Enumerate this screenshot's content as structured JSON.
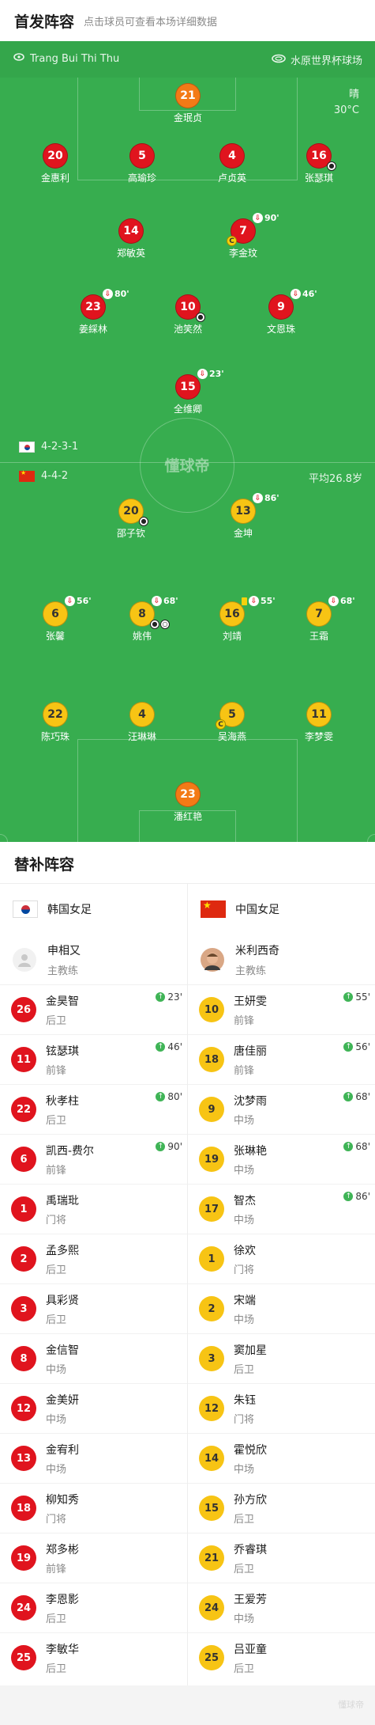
{
  "header": {
    "title": "首发阵容",
    "subtitle": "点击球员可查看本场详细数据"
  },
  "pitch": {
    "referee": "Trang Bui Thi Thu",
    "venue": "水原世界杯球场",
    "weather": "晴",
    "temperature": "30°C",
    "watermark": "懂球帝",
    "home_formation": "4-2-3-1",
    "away_formation": "4-4-2",
    "avg_age": "平均26.8岁"
  },
  "home_lineup": {
    "gk": {
      "num": "21",
      "name": "金珉贞"
    },
    "d1": {
      "num": "20",
      "name": "金惠利"
    },
    "d2": {
      "num": "5",
      "name": "高瑜珍"
    },
    "d3": {
      "num": "4",
      "name": "卢贞英"
    },
    "d4": {
      "num": "16",
      "name": "张瑟琪"
    },
    "m1": {
      "num": "14",
      "name": "郑敏英"
    },
    "m2": {
      "num": "7",
      "name": "李金玟",
      "sub": "90'"
    },
    "a1": {
      "num": "23",
      "name": "姜綵林",
      "sub": "80'"
    },
    "a2": {
      "num": "10",
      "name": "池笑然"
    },
    "a3": {
      "num": "9",
      "name": "文恩珠",
      "sub": "46'"
    },
    "st": {
      "num": "15",
      "name": "全维卿",
      "sub": "23'"
    }
  },
  "away_lineup": {
    "f1": {
      "num": "20",
      "name": "邵子钦"
    },
    "f2": {
      "num": "13",
      "name": "金坤",
      "sub": "86'"
    },
    "m1": {
      "num": "6",
      "name": "张馨",
      "sub": "56'"
    },
    "m2": {
      "num": "8",
      "name": "姚伟",
      "sub": "68'"
    },
    "m3": {
      "num": "16",
      "name": "刘靖",
      "sub": "55'"
    },
    "m4": {
      "num": "7",
      "name": "王霜",
      "sub": "68'"
    },
    "d1": {
      "num": "22",
      "name": "陈巧珠"
    },
    "d2": {
      "num": "4",
      "name": "汪琳琳"
    },
    "d3": {
      "num": "5",
      "name": "吴海燕"
    },
    "d4": {
      "num": "11",
      "name": "李梦雯"
    },
    "gk": {
      "num": "23",
      "name": "潘红艳"
    }
  },
  "subs": {
    "title": "替补阵容",
    "home": {
      "team": "韩国女足",
      "coach_name": "申相又",
      "coach_role": "主教练",
      "players": [
        {
          "num": "26",
          "name": "金昊智",
          "pos": "后卫",
          "event": "23'"
        },
        {
          "num": "11",
          "name": "铉瑟琪",
          "pos": "前锋",
          "event": "46'"
        },
        {
          "num": "22",
          "name": "秋孝柱",
          "pos": "后卫",
          "event": "80'"
        },
        {
          "num": "6",
          "name": "凯西-费尔",
          "pos": "前锋",
          "event": "90'"
        },
        {
          "num": "1",
          "name": "禹瑞玭",
          "pos": "门将"
        },
        {
          "num": "2",
          "name": "孟多熙",
          "pos": "后卫"
        },
        {
          "num": "3",
          "name": "具彩贤",
          "pos": "后卫"
        },
        {
          "num": "8",
          "name": "金信智",
          "pos": "中场"
        },
        {
          "num": "12",
          "name": "金美妍",
          "pos": "中场"
        },
        {
          "num": "13",
          "name": "金宥利",
          "pos": "中场"
        },
        {
          "num": "18",
          "name": "柳知秀",
          "pos": "门将"
        },
        {
          "num": "19",
          "name": "郑多彬",
          "pos": "前锋"
        },
        {
          "num": "24",
          "name": "李恩影",
          "pos": "后卫"
        },
        {
          "num": "25",
          "name": "李敏华",
          "pos": "后卫"
        }
      ]
    },
    "away": {
      "team": "中国女足",
      "coach_name": "米利西奇",
      "coach_role": "主教练",
      "players": [
        {
          "num": "10",
          "name": "王妍雯",
          "pos": "前锋",
          "event": "55'"
        },
        {
          "num": "18",
          "name": "唐佳丽",
          "pos": "前锋",
          "event": "56'"
        },
        {
          "num": "9",
          "name": "沈梦雨",
          "pos": "中场",
          "event": "68'"
        },
        {
          "num": "19",
          "name": "张琳艳",
          "pos": "中场",
          "event": "68'"
        },
        {
          "num": "17",
          "name": "智杰",
          "pos": "中场",
          "event": "86'"
        },
        {
          "num": "1",
          "name": "徐欢",
          "pos": "门将"
        },
        {
          "num": "2",
          "name": "宋端",
          "pos": "中场"
        },
        {
          "num": "3",
          "name": "窦加星",
          "pos": "后卫"
        },
        {
          "num": "12",
          "name": "朱钰",
          "pos": "门将"
        },
        {
          "num": "14",
          "name": "霍悦欣",
          "pos": "中场"
        },
        {
          "num": "15",
          "name": "孙方欣",
          "pos": "后卫"
        },
        {
          "num": "21",
          "name": "乔睿琪",
          "pos": "后卫"
        },
        {
          "num": "24",
          "name": "王爱芳",
          "pos": "中场"
        },
        {
          "num": "25",
          "name": "吕亚童",
          "pos": "后卫"
        }
      ]
    }
  },
  "colors": {
    "pitch": "#37ad4f",
    "home": "#e0141e",
    "away": "#f7c414",
    "gk": "#f37a16"
  }
}
